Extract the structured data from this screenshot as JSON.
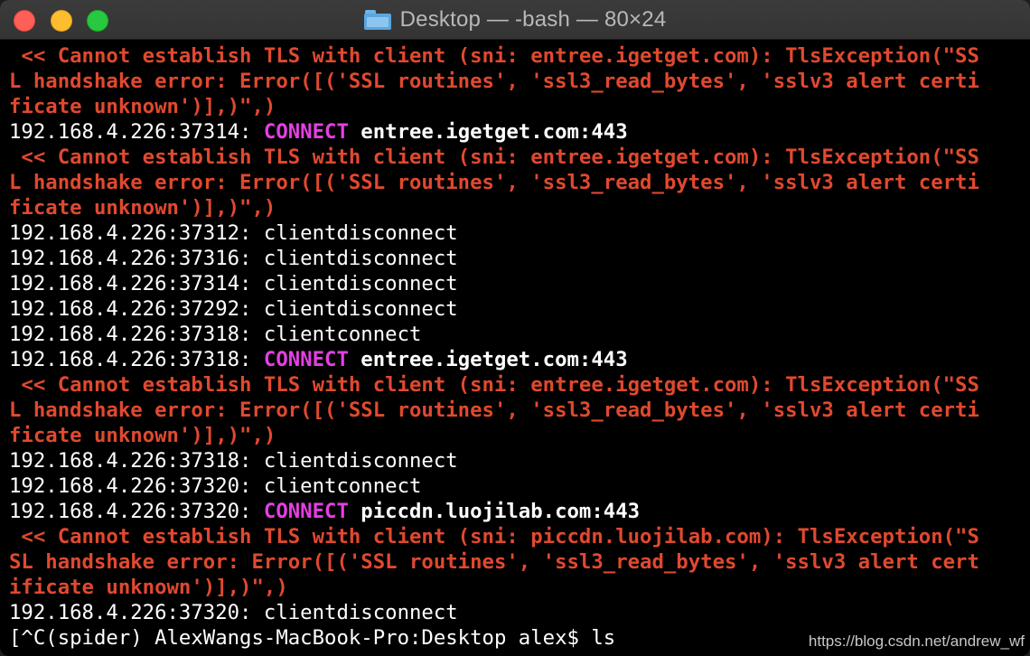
{
  "window": {
    "title": "Desktop — -bash — 80×24",
    "folder_icon": "folder-icon"
  },
  "colors": {
    "error": "#e0492f",
    "connect": "#e53fe3",
    "text": "#ffffff",
    "background": "#000000"
  },
  "terminal": {
    "lines": [
      {
        "kind": "err",
        "text": " << Cannot establish TLS with client (sni: entree.igetget.com): TlsException(\"SS"
      },
      {
        "kind": "err",
        "text": "L handshake error: Error([('SSL routines', 'ssl3_read_bytes', 'sslv3 alert certi"
      },
      {
        "kind": "err",
        "text": "ficate unknown')],)\",)"
      },
      {
        "kind": "connect",
        "prefix": "192.168.4.226:37314: ",
        "verb": "CONNECT",
        "host": " entree.igetget.com:443"
      },
      {
        "kind": "err",
        "text": " << Cannot establish TLS with client (sni: entree.igetget.com): TlsException(\"SS"
      },
      {
        "kind": "err",
        "text": "L handshake error: Error([('SSL routines', 'ssl3_read_bytes', 'sslv3 alert certi"
      },
      {
        "kind": "err",
        "text": "ficate unknown')],)\",)"
      },
      {
        "kind": "plain",
        "text": "192.168.4.226:37312: clientdisconnect"
      },
      {
        "kind": "plain",
        "text": "192.168.4.226:37316: clientdisconnect"
      },
      {
        "kind": "plain",
        "text": "192.168.4.226:37314: clientdisconnect"
      },
      {
        "kind": "plain",
        "text": "192.168.4.226:37292: clientdisconnect"
      },
      {
        "kind": "plain",
        "text": "192.168.4.226:37318: clientconnect"
      },
      {
        "kind": "connect",
        "prefix": "192.168.4.226:37318: ",
        "verb": "CONNECT",
        "host": " entree.igetget.com:443"
      },
      {
        "kind": "err",
        "text": " << Cannot establish TLS with client (sni: entree.igetget.com): TlsException(\"SS"
      },
      {
        "kind": "err",
        "text": "L handshake error: Error([('SSL routines', 'ssl3_read_bytes', 'sslv3 alert certi"
      },
      {
        "kind": "err",
        "text": "ficate unknown')],)\",)"
      },
      {
        "kind": "plain",
        "text": "192.168.4.226:37318: clientdisconnect"
      },
      {
        "kind": "plain",
        "text": "192.168.4.226:37320: clientconnect"
      },
      {
        "kind": "connect",
        "prefix": "192.168.4.226:37320: ",
        "verb": "CONNECT",
        "host": " piccdn.luojilab.com:443"
      },
      {
        "kind": "err",
        "text": " << Cannot establish TLS with client (sni: piccdn.luojilab.com): TlsException(\"S"
      },
      {
        "kind": "err",
        "text": "SL handshake error: Error([('SSL routines', 'ssl3_read_bytes', 'sslv3 alert cert"
      },
      {
        "kind": "err",
        "text": "ificate unknown')],)\",)"
      },
      {
        "kind": "plain",
        "text": "192.168.4.226:37320: clientdisconnect"
      },
      {
        "kind": "prompt",
        "text": "[^C(spider) AlexWangs-MacBook-Pro:Desktop alex$ ls"
      }
    ]
  },
  "watermark": "https://blog.csdn.net/andrew_wf"
}
